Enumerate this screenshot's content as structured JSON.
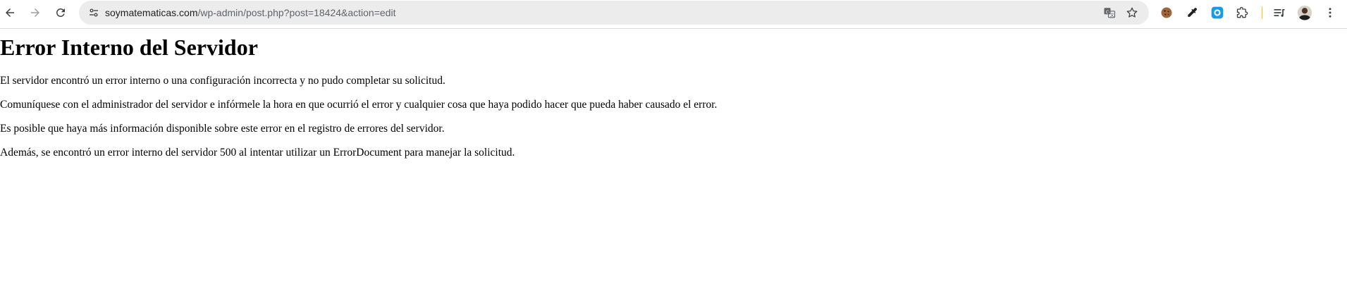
{
  "browser": {
    "url_host": "soymatematicas.com",
    "url_path": "/wp-admin/post.php?post=18424&action=edit",
    "icons": {
      "back": "arrow-left-icon",
      "forward": "arrow-right-icon",
      "reload": "reload-icon",
      "site_info": "tune-icon",
      "translate": "translate-icon",
      "bookmark": "star-icon",
      "extensions": [
        "cookie-icon",
        "eyedropper-icon",
        "blue-extension-icon",
        "puzzle-icon"
      ],
      "reading_list": "reading-list-icon",
      "profile": "avatar",
      "menu": "kebab-menu-icon"
    }
  },
  "page": {
    "title": "Error Interno del Servidor",
    "paragraphs": [
      "El servidor encontró un error interno o una configuración incorrecta y no pudo completar su solicitud.",
      "Comuníquese con el administrador del servidor e infórmele la hora en que ocurrió el error y cualquier cosa que haya podido hacer que pueda haber causado el error.",
      "Es posible que haya más información disponible sobre este error en el registro de errores del servidor.",
      "Además, se encontró un error interno del servidor 500 al intentar utilizar un ErrorDocument para manejar la solicitud."
    ]
  }
}
